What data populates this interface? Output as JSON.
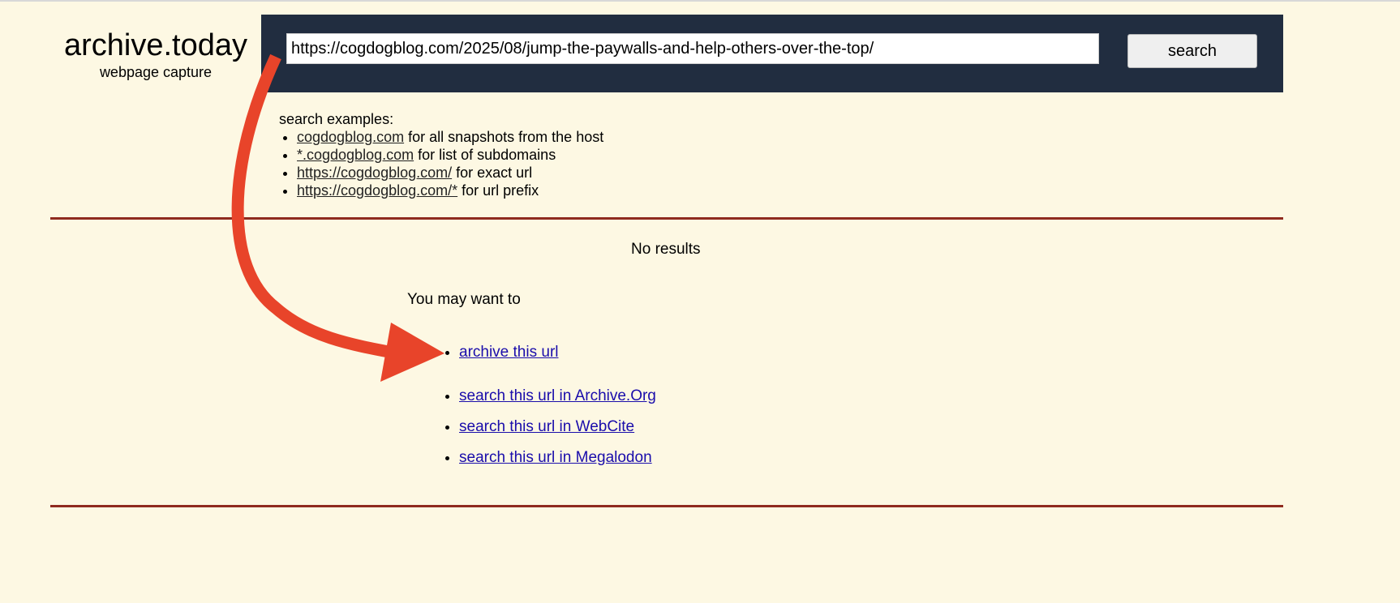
{
  "logo": {
    "title": "archive.today",
    "subtitle": "webpage capture"
  },
  "search": {
    "value": "https://cogdogblog.com/2025/08/jump-the-paywalls-and-help-others-over-the-top/",
    "button_label": "search"
  },
  "examples": {
    "heading": "search examples:",
    "items": [
      {
        "link": "cogdogblog.com",
        "text": " for all snapshots from the host"
      },
      {
        "link": "*.cogdogblog.com",
        "text": " for list of subdomains"
      },
      {
        "link": "https://cogdogblog.com/",
        "text": " for exact url"
      },
      {
        "link": "https://cogdogblog.com/*",
        "text": " for url prefix"
      }
    ]
  },
  "results": {
    "status": "No results",
    "suggestion_heading": "You may want to",
    "actions": [
      "archive this url",
      "search this url in Archive.Org",
      "search this url in WebCite",
      "search this url in Megalodon"
    ]
  },
  "colors": {
    "background": "#fdf8e3",
    "header_bar": "#212d40",
    "divider": "#8f2b1f",
    "link": "#1a0dab",
    "annotation_arrow": "#e8442a"
  },
  "icons": {
    "annotation": "curved-arrow-icon"
  }
}
